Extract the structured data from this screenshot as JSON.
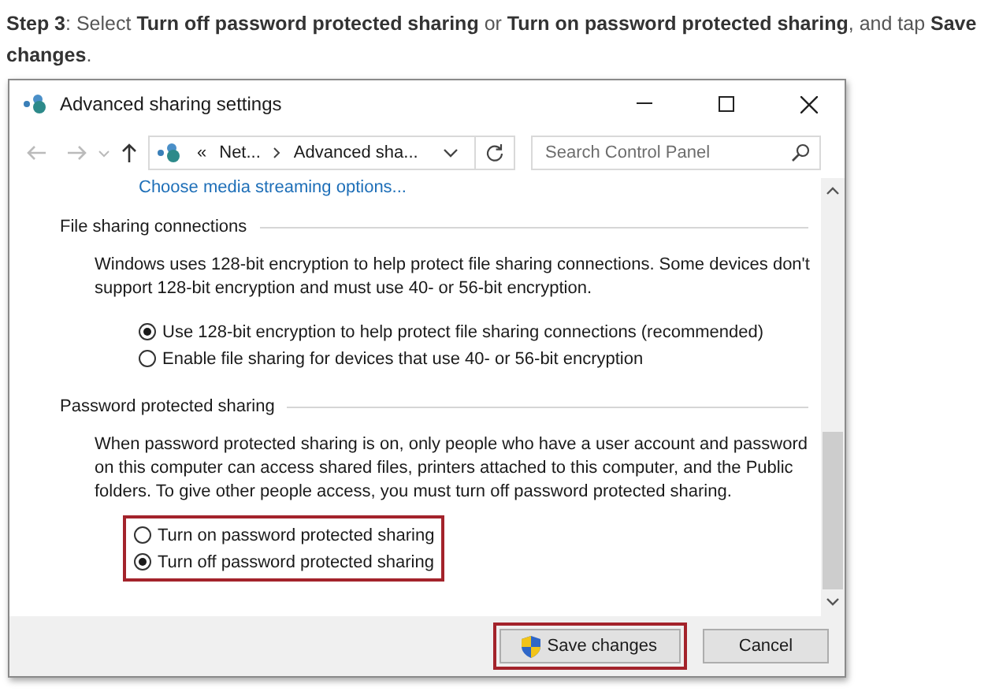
{
  "instruction": "**Step 3**: Select **Turn off password protected sharing** or **Turn on password protected sharing**, and tap **Save changes**.",
  "window": {
    "title": "Advanced sharing settings",
    "address": {
      "separator": "«",
      "crumbs": [
        "Net...",
        "Advanced sha..."
      ]
    },
    "search": {
      "placeholder": "Search Control Panel"
    },
    "link": "Choose media streaming options...",
    "sections": [
      {
        "title": "File sharing connections",
        "description": "Windows uses 128-bit encryption to help protect file sharing connections. Some devices don't support 128-bit encryption and must use 40- or 56-bit encryption.",
        "highlighted": false,
        "options": [
          {
            "label": "Use 128-bit encryption to help protect file sharing connections (recommended)",
            "selected": true
          },
          {
            "label": "Enable file sharing for devices that use 40- or 56-bit encryption",
            "selected": false
          }
        ]
      },
      {
        "title": "Password protected sharing",
        "description": "When password protected sharing is on, only people who have a user account and password on this computer can access shared files, printers attached to this computer, and the Public folders. To give other people access, you must turn off password protected sharing.",
        "highlighted": true,
        "options": [
          {
            "label": "Turn on password protected sharing",
            "selected": false
          },
          {
            "label": "Turn off password protected sharing",
            "selected": true
          }
        ]
      }
    ],
    "buttons": [
      {
        "label": "Save changes",
        "kind": "shield",
        "highlighted": true
      },
      {
        "label": "Cancel",
        "kind": "plain",
        "highlighted": false
      }
    ]
  }
}
